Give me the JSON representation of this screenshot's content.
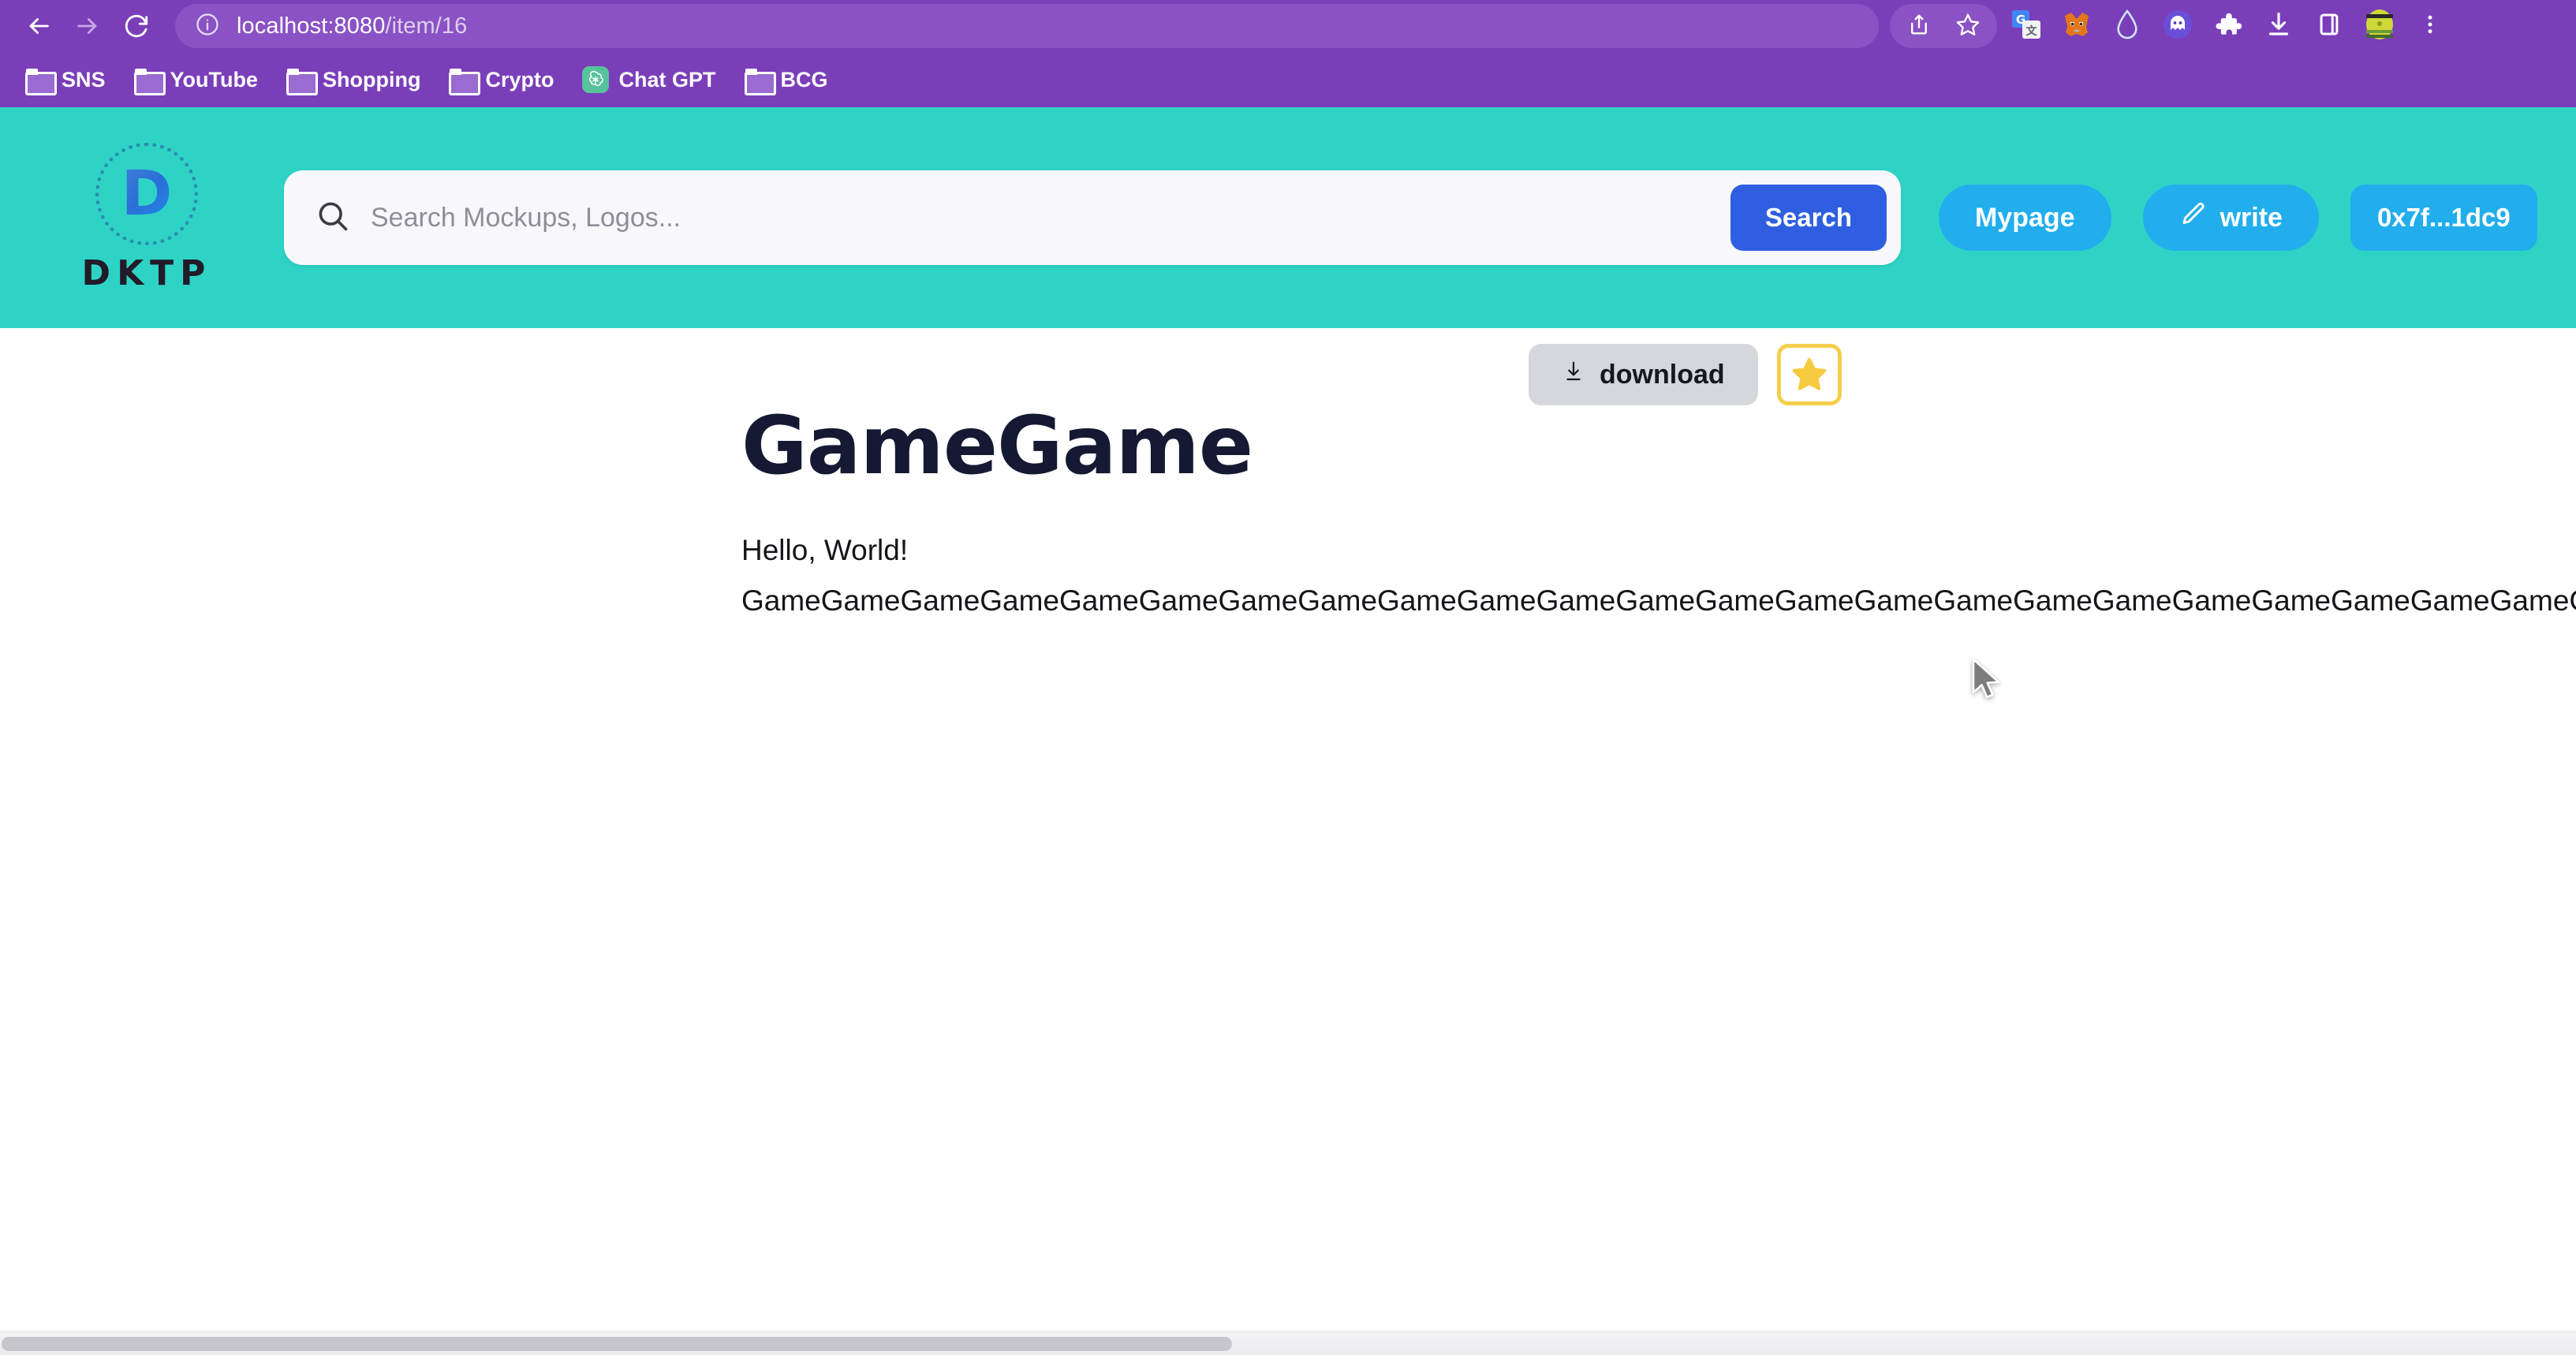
{
  "browser": {
    "nav": {
      "back_icon": "arrow-left-icon",
      "forward_icon": "arrow-right-icon",
      "reload_icon": "reload-icon"
    },
    "omnibox": {
      "info_icon": "info-circle-icon",
      "url_host": "localhost:8080",
      "url_path": "/item/16",
      "full_url": "localhost:8080/item/16"
    },
    "omni_actions": [
      {
        "name": "share-icon",
        "glyph": "share"
      },
      {
        "name": "bookmark-star-icon",
        "glyph": "star-outline"
      }
    ],
    "extensions": [
      {
        "name": "google-translate-icon",
        "label": "Google Translate"
      },
      {
        "name": "metamask-fox-icon",
        "label": "MetaMask"
      },
      {
        "name": "water-drop-icon",
        "label": "Drop"
      },
      {
        "name": "ghost-icon",
        "label": "Ghost"
      },
      {
        "name": "puzzle-piece-icon",
        "label": "Extensions"
      },
      {
        "name": "download-tray-icon",
        "label": "Downloads"
      },
      {
        "name": "side-panel-icon",
        "label": "Side panel"
      },
      {
        "name": "profile-avatar-icon",
        "label": "Profile"
      },
      {
        "name": "kebab-menu-icon",
        "label": "Customize and control"
      }
    ],
    "bookmarks": [
      {
        "label": "SNS",
        "icon": "folder-icon"
      },
      {
        "label": "YouTube",
        "icon": "folder-icon"
      },
      {
        "label": "Shopping",
        "icon": "folder-icon"
      },
      {
        "label": "Crypto",
        "icon": "folder-icon"
      },
      {
        "label": "Chat GPT",
        "icon": "chatgpt-icon"
      },
      {
        "label": "BCG",
        "icon": "folder-icon"
      }
    ]
  },
  "site": {
    "logo": {
      "mark_letter": "D",
      "wordmark": "DKTP"
    },
    "search": {
      "icon": "search-icon",
      "placeholder": "Search Mockups, Logos...",
      "value": "",
      "button_label": "Search"
    },
    "actions": {
      "mypage_label": "Mypage",
      "write_label": "write",
      "write_icon": "pencil-icon",
      "wallet_label": "0x7f...1dc9"
    },
    "colors": {
      "header_bg": "#2ed3c6",
      "search_button": "#2f5fe0",
      "action_button": "#22aeed",
      "star_border": "#f5cf4b",
      "star_fill": "#f7cb3f",
      "browser_chrome": "#7b3eb9"
    }
  },
  "item": {
    "download_label": "download",
    "download_icon": "download-icon",
    "favorite_icon": "star-filled-icon",
    "title": "GameGame",
    "body_line_1": "Hello, World!",
    "body_line_2": "GameGameGameGameGameGameGameGameGameGameGameGameGameGameGameGameGameGameGameGameGameGameGameGameGameGameGameGameGameGameGameGameGameGameGameGameGame"
  }
}
